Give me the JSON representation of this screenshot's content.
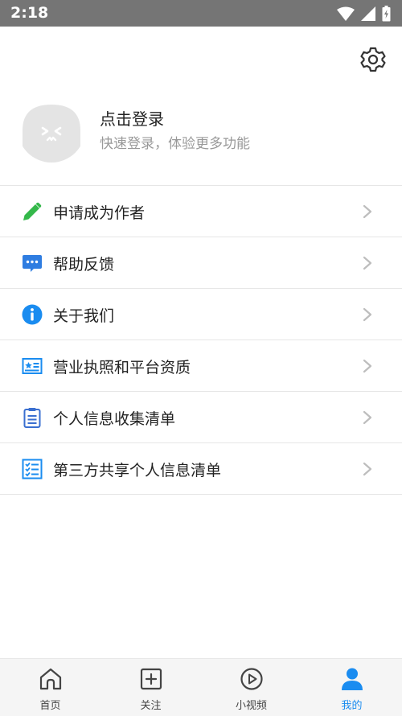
{
  "status_bar": {
    "time": "2:18"
  },
  "profile": {
    "login_title": "点击登录",
    "login_subtitle": "快速登录，体验更多功能"
  },
  "menu": {
    "items": [
      {
        "label": "申请成为作者",
        "icon": "pencil-icon",
        "color": "#34b84a"
      },
      {
        "label": "帮助反馈",
        "icon": "chat-bubble-icon",
        "color": "#2f7de1"
      },
      {
        "label": "关于我们",
        "icon": "info-icon",
        "color": "#1a8cf0"
      },
      {
        "label": "营业执照和平台资质",
        "icon": "license-card-icon",
        "color": "#1a8cf0"
      },
      {
        "label": "个人信息收集清单",
        "icon": "clipboard-list-icon",
        "color": "#3a6fd0"
      },
      {
        "label": "第三方共享个人信息清单",
        "icon": "checklist-icon",
        "color": "#1a8cf0"
      }
    ]
  },
  "tabbar": {
    "active_color": "#1a8cf0",
    "tabs": [
      {
        "label": "首页",
        "icon": "home-icon"
      },
      {
        "label": "关注",
        "icon": "add-square-icon"
      },
      {
        "label": "小视频",
        "icon": "play-circle-icon"
      },
      {
        "label": "我的",
        "icon": "person-icon",
        "active": true
      }
    ]
  }
}
